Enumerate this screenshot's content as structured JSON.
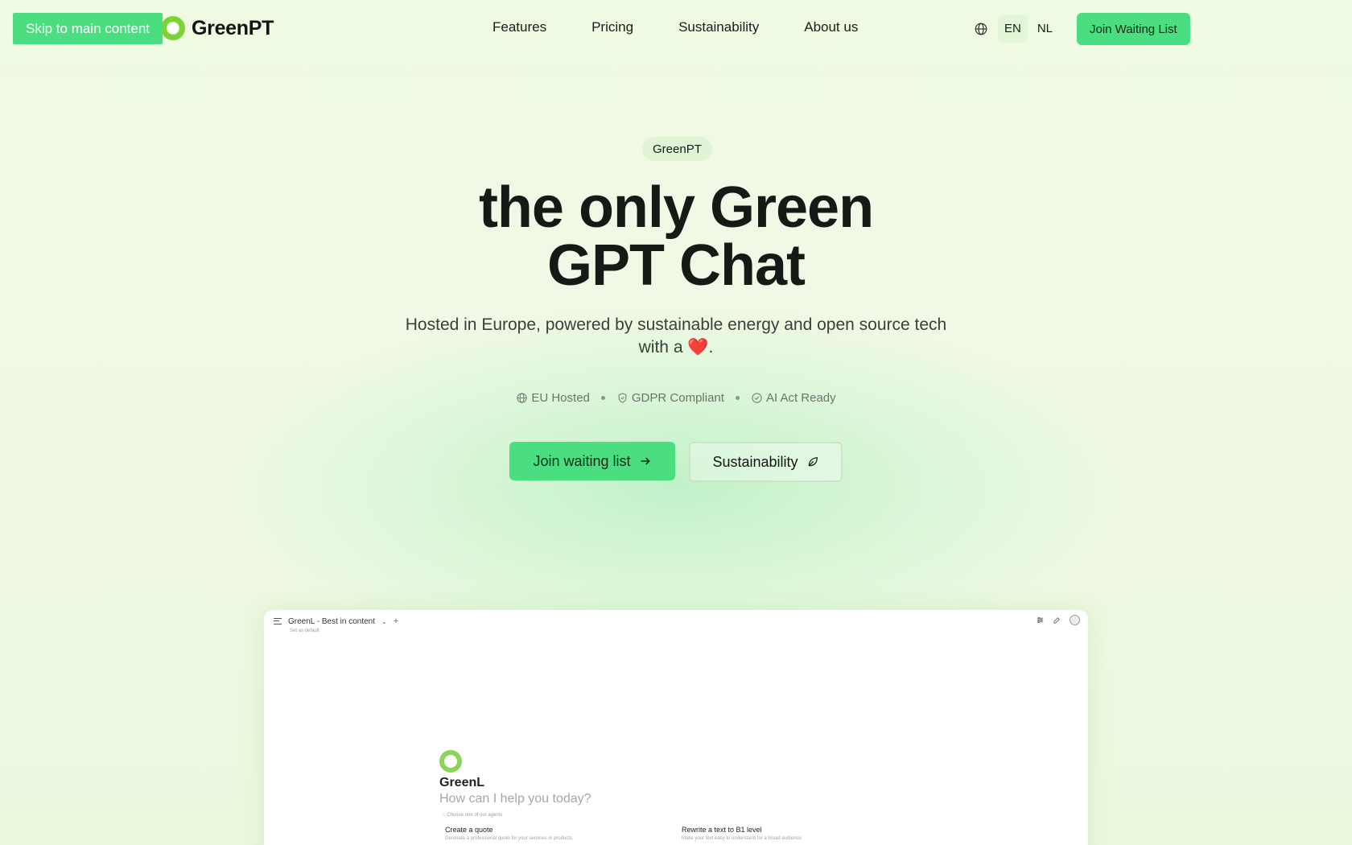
{
  "skip_link": "Skip to main content",
  "brand": {
    "name": "GreenPT"
  },
  "nav": {
    "items": [
      "Features",
      "Pricing",
      "Sustainability",
      "About us"
    ]
  },
  "language": {
    "options": [
      "EN",
      "NL"
    ],
    "selected": "EN"
  },
  "header_cta": "Join Waiting List",
  "hero": {
    "badge": "GreenPT",
    "headline_line1": "the only Green",
    "headline_line2": "GPT Chat",
    "subhead_main": "Hosted in Europe, powered by sustainable energy and open source tech with a",
    "subhead_end": ".",
    "trust": [
      "EU Hosted",
      "GDPR Compliant",
      "AI Act Ready"
    ],
    "cta_primary": "Join waiting list",
    "cta_secondary": "Sustainability"
  },
  "preview": {
    "model_title": "GreenL - Best in content",
    "set_default": "Set as default",
    "assistant_name": "GreenL",
    "prompt": "How can I help you today?",
    "agents_hint": "Choose one of our agents",
    "cards": [
      {
        "title": "Create a quote",
        "desc": "Generate a professional quote for your services or products."
      },
      {
        "title": "Rewrite a text to B1 level",
        "desc": "Make your text easy to understand for a broad audience."
      }
    ]
  },
  "colors": {
    "accent": "#4ade80",
    "background": "#f1f9e6",
    "logo_green": "#7bd437"
  }
}
